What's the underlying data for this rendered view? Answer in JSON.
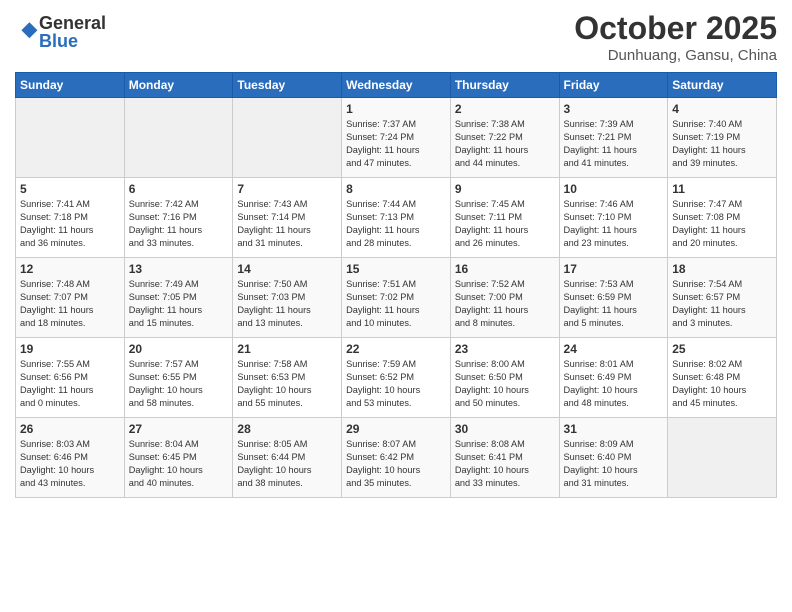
{
  "logo": {
    "general": "General",
    "blue": "Blue"
  },
  "header": {
    "month": "October 2025",
    "location": "Dunhuang, Gansu, China"
  },
  "weekdays": [
    "Sunday",
    "Monday",
    "Tuesday",
    "Wednesday",
    "Thursday",
    "Friday",
    "Saturday"
  ],
  "weeks": [
    [
      {
        "day": "",
        "info": ""
      },
      {
        "day": "",
        "info": ""
      },
      {
        "day": "",
        "info": ""
      },
      {
        "day": "1",
        "info": "Sunrise: 7:37 AM\nSunset: 7:24 PM\nDaylight: 11 hours\nand 47 minutes."
      },
      {
        "day": "2",
        "info": "Sunrise: 7:38 AM\nSunset: 7:22 PM\nDaylight: 11 hours\nand 44 minutes."
      },
      {
        "day": "3",
        "info": "Sunrise: 7:39 AM\nSunset: 7:21 PM\nDaylight: 11 hours\nand 41 minutes."
      },
      {
        "day": "4",
        "info": "Sunrise: 7:40 AM\nSunset: 7:19 PM\nDaylight: 11 hours\nand 39 minutes."
      }
    ],
    [
      {
        "day": "5",
        "info": "Sunrise: 7:41 AM\nSunset: 7:18 PM\nDaylight: 11 hours\nand 36 minutes."
      },
      {
        "day": "6",
        "info": "Sunrise: 7:42 AM\nSunset: 7:16 PM\nDaylight: 11 hours\nand 33 minutes."
      },
      {
        "day": "7",
        "info": "Sunrise: 7:43 AM\nSunset: 7:14 PM\nDaylight: 11 hours\nand 31 minutes."
      },
      {
        "day": "8",
        "info": "Sunrise: 7:44 AM\nSunset: 7:13 PM\nDaylight: 11 hours\nand 28 minutes."
      },
      {
        "day": "9",
        "info": "Sunrise: 7:45 AM\nSunset: 7:11 PM\nDaylight: 11 hours\nand 26 minutes."
      },
      {
        "day": "10",
        "info": "Sunrise: 7:46 AM\nSunset: 7:10 PM\nDaylight: 11 hours\nand 23 minutes."
      },
      {
        "day": "11",
        "info": "Sunrise: 7:47 AM\nSunset: 7:08 PM\nDaylight: 11 hours\nand 20 minutes."
      }
    ],
    [
      {
        "day": "12",
        "info": "Sunrise: 7:48 AM\nSunset: 7:07 PM\nDaylight: 11 hours\nand 18 minutes."
      },
      {
        "day": "13",
        "info": "Sunrise: 7:49 AM\nSunset: 7:05 PM\nDaylight: 11 hours\nand 15 minutes."
      },
      {
        "day": "14",
        "info": "Sunrise: 7:50 AM\nSunset: 7:03 PM\nDaylight: 11 hours\nand 13 minutes."
      },
      {
        "day": "15",
        "info": "Sunrise: 7:51 AM\nSunset: 7:02 PM\nDaylight: 11 hours\nand 10 minutes."
      },
      {
        "day": "16",
        "info": "Sunrise: 7:52 AM\nSunset: 7:00 PM\nDaylight: 11 hours\nand 8 minutes."
      },
      {
        "day": "17",
        "info": "Sunrise: 7:53 AM\nSunset: 6:59 PM\nDaylight: 11 hours\nand 5 minutes."
      },
      {
        "day": "18",
        "info": "Sunrise: 7:54 AM\nSunset: 6:57 PM\nDaylight: 11 hours\nand 3 minutes."
      }
    ],
    [
      {
        "day": "19",
        "info": "Sunrise: 7:55 AM\nSunset: 6:56 PM\nDaylight: 11 hours\nand 0 minutes."
      },
      {
        "day": "20",
        "info": "Sunrise: 7:57 AM\nSunset: 6:55 PM\nDaylight: 10 hours\nand 58 minutes."
      },
      {
        "day": "21",
        "info": "Sunrise: 7:58 AM\nSunset: 6:53 PM\nDaylight: 10 hours\nand 55 minutes."
      },
      {
        "day": "22",
        "info": "Sunrise: 7:59 AM\nSunset: 6:52 PM\nDaylight: 10 hours\nand 53 minutes."
      },
      {
        "day": "23",
        "info": "Sunrise: 8:00 AM\nSunset: 6:50 PM\nDaylight: 10 hours\nand 50 minutes."
      },
      {
        "day": "24",
        "info": "Sunrise: 8:01 AM\nSunset: 6:49 PM\nDaylight: 10 hours\nand 48 minutes."
      },
      {
        "day": "25",
        "info": "Sunrise: 8:02 AM\nSunset: 6:48 PM\nDaylight: 10 hours\nand 45 minutes."
      }
    ],
    [
      {
        "day": "26",
        "info": "Sunrise: 8:03 AM\nSunset: 6:46 PM\nDaylight: 10 hours\nand 43 minutes."
      },
      {
        "day": "27",
        "info": "Sunrise: 8:04 AM\nSunset: 6:45 PM\nDaylight: 10 hours\nand 40 minutes."
      },
      {
        "day": "28",
        "info": "Sunrise: 8:05 AM\nSunset: 6:44 PM\nDaylight: 10 hours\nand 38 minutes."
      },
      {
        "day": "29",
        "info": "Sunrise: 8:07 AM\nSunset: 6:42 PM\nDaylight: 10 hours\nand 35 minutes."
      },
      {
        "day": "30",
        "info": "Sunrise: 8:08 AM\nSunset: 6:41 PM\nDaylight: 10 hours\nand 33 minutes."
      },
      {
        "day": "31",
        "info": "Sunrise: 8:09 AM\nSunset: 6:40 PM\nDaylight: 10 hours\nand 31 minutes."
      },
      {
        "day": "",
        "info": ""
      }
    ]
  ]
}
